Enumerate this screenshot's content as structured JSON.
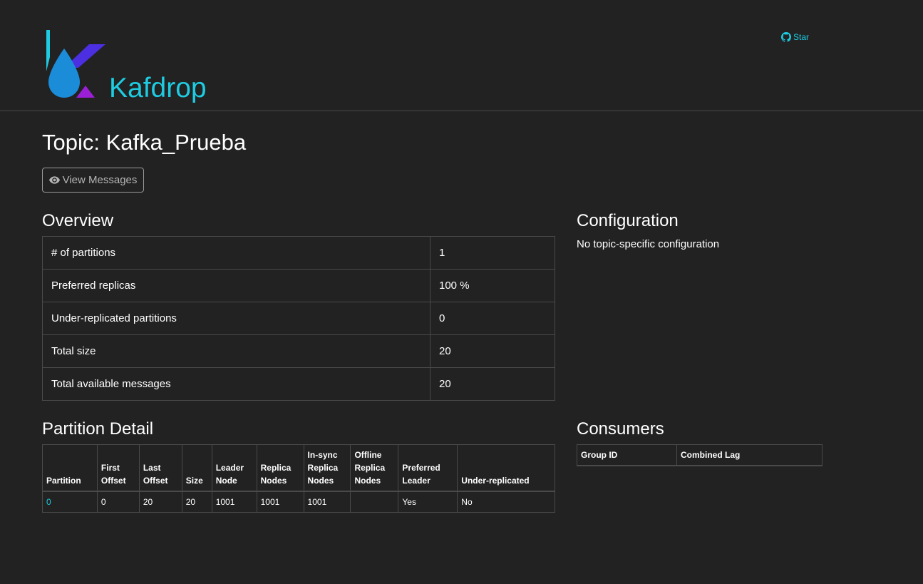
{
  "header": {
    "brand": "Kafdrop",
    "star_label": "Star",
    "accent_color": "#1ecbe1"
  },
  "page": {
    "title": "Topic: Kafka_Prueba",
    "view_messages_label": "View Messages"
  },
  "overview": {
    "heading": "Overview",
    "rows": [
      {
        "label": "# of partitions",
        "value": "1"
      },
      {
        "label": "Preferred replicas",
        "value": "100 %"
      },
      {
        "label": "Under-replicated partitions",
        "value": "0"
      },
      {
        "label": "Total size",
        "value": "20"
      },
      {
        "label": "Total available messages",
        "value": "20"
      }
    ]
  },
  "configuration": {
    "heading": "Configuration",
    "text": "No topic-specific configuration"
  },
  "partition_detail": {
    "heading": "Partition Detail",
    "columns": [
      [
        "Partition"
      ],
      [
        "First",
        "Offset"
      ],
      [
        "Last",
        "Offset"
      ],
      [
        "Size"
      ],
      [
        "Leader",
        "Node"
      ],
      [
        "Replica",
        "Nodes"
      ],
      [
        "In-sync",
        "Replica",
        "Nodes"
      ],
      [
        "Offline",
        "Replica",
        "Nodes"
      ],
      [
        "Preferred",
        "Leader"
      ],
      [
        "Under-replicated"
      ]
    ],
    "rows": [
      [
        "0",
        "0",
        "20",
        "20",
        "1001",
        "1001",
        "1001",
        "",
        "Yes",
        "No"
      ]
    ]
  },
  "consumers": {
    "heading": "Consumers",
    "columns": [
      "Group ID",
      "Combined Lag"
    ]
  }
}
